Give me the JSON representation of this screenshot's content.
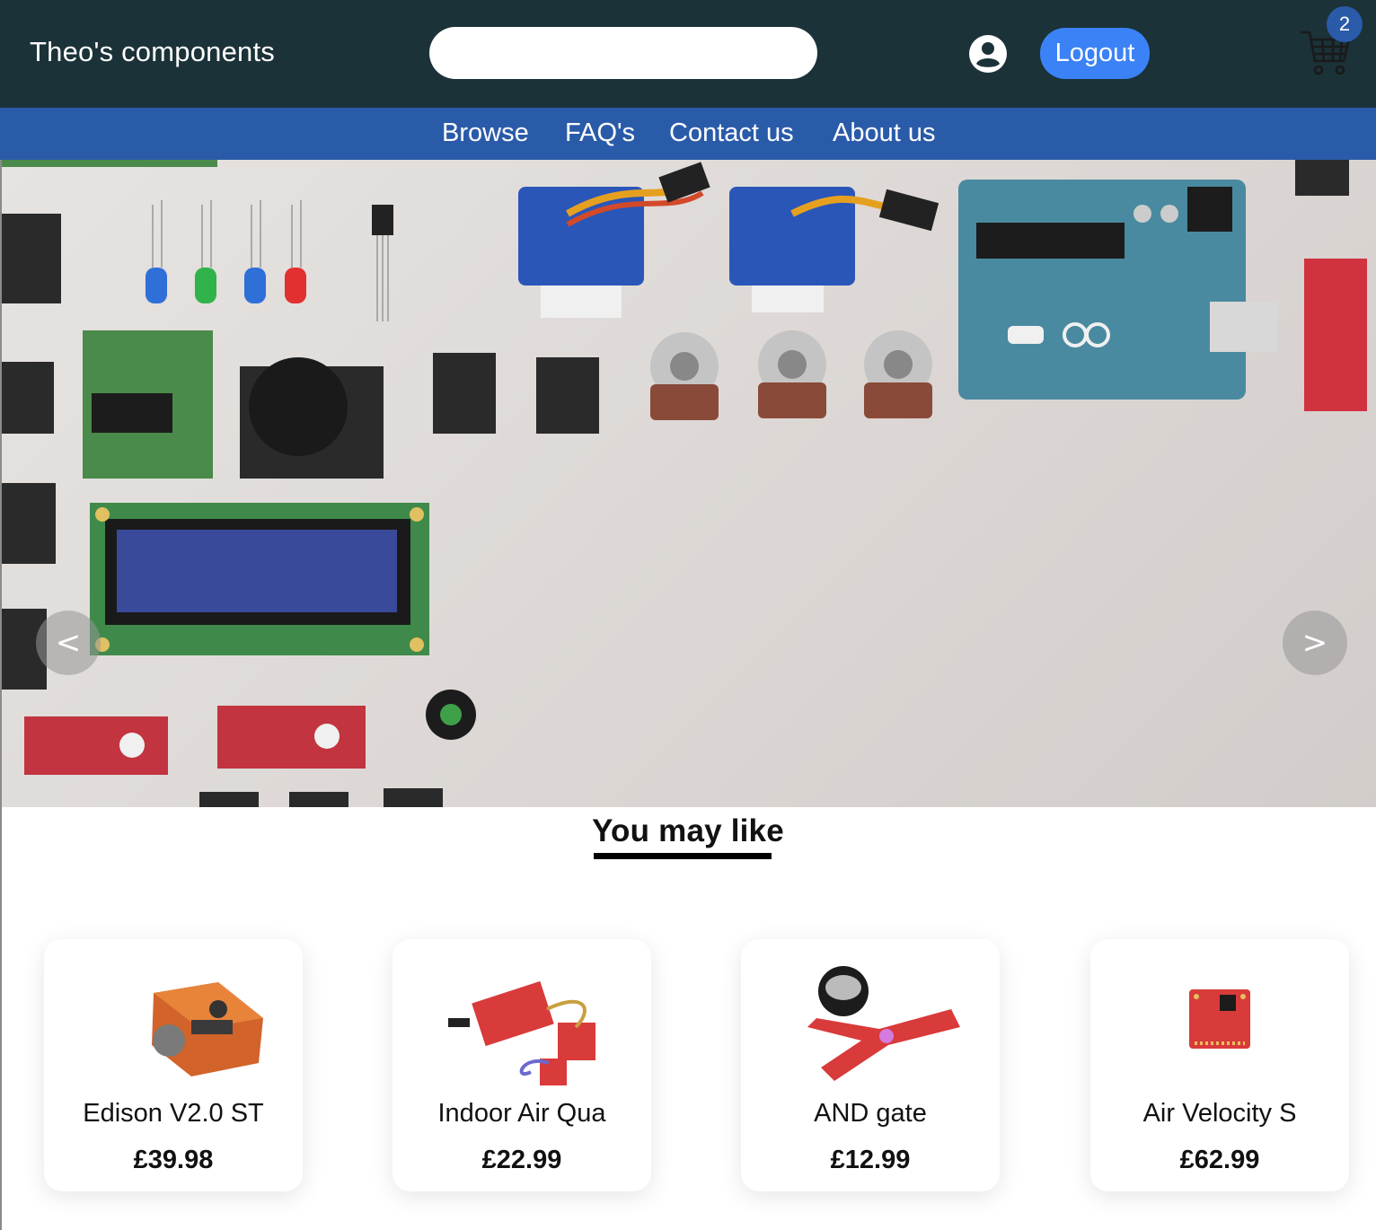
{
  "header": {
    "brand": "Theo's components",
    "search": {
      "value": "",
      "placeholder": ""
    },
    "account_icon": "user-circle-icon",
    "logout_label": "Logout",
    "cart_icon": "shopping-cart-icon",
    "cart_count": "2"
  },
  "nav": {
    "items": [
      {
        "label": "Browse"
      },
      {
        "label": "FAQ's"
      },
      {
        "label": "Contact us"
      },
      {
        "label": "About us"
      }
    ]
  },
  "carousel": {
    "prev_label": "<",
    "next_label": ">"
  },
  "recommendations": {
    "title": "You may like",
    "products": [
      {
        "name": "Edison V2.0 ST",
        "price": "£39.98"
      },
      {
        "name": "Indoor Air Qua",
        "price": "£22.99"
      },
      {
        "name": "AND gate",
        "price": "£12.99"
      },
      {
        "name": "Air Velocity S",
        "price": "£62.99"
      }
    ]
  },
  "colors": {
    "header_bg": "#1b3238",
    "nav_bg": "#2a5ba9",
    "accent": "#3b82f6",
    "badge": "#2a5ba9"
  }
}
